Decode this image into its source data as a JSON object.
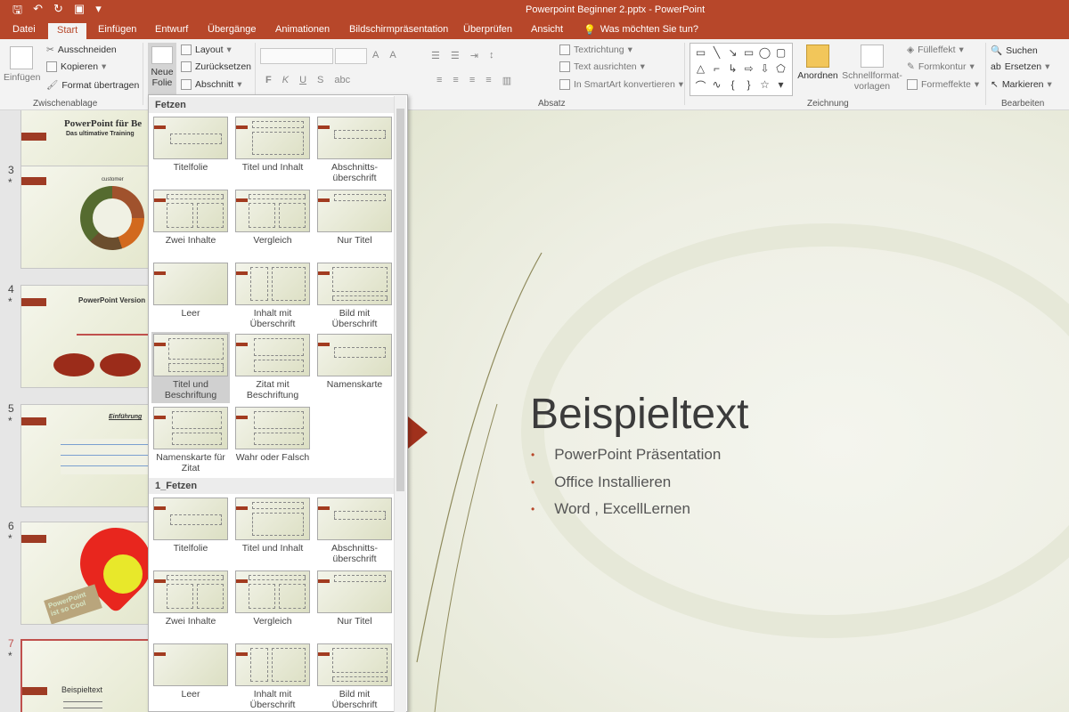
{
  "window": {
    "doc_title": "Powerpoint Beginner 2.pptx - PowerPoint"
  },
  "tabs": [
    "Datei",
    "Start",
    "Einfügen",
    "Entwurf",
    "Übergänge",
    "Animationen",
    "Bildschirmpräsentation",
    "Überprüfen",
    "Ansicht"
  ],
  "tell_me": "Was möchten Sie tun?",
  "ribbon": {
    "clipboard": {
      "paste": "Einfügen",
      "cut": "Ausschneiden",
      "copy": "Kopieren",
      "format_painter": "Format übertragen",
      "label": "Zwischenablage"
    },
    "slides": {
      "new_slide_1": "Neue",
      "new_slide_2": "Folie",
      "layout": "Layout",
      "reset": "Zurücksetzen",
      "section": "Abschnitt"
    },
    "paragraph": {
      "text_direction": "Textrichtung",
      "align_text": "Text ausrichten",
      "smartart": "In SmartArt konvertieren",
      "label": "Absatz"
    },
    "drawing": {
      "arrange": "Anordnen",
      "quick_styles_1": "Schnellformat-",
      "quick_styles_2": "vorlagen",
      "fill": "Fülleffekt",
      "outline": "Formkontur",
      "effects": "Formeffekte",
      "label": "Zeichnung"
    },
    "editing": {
      "find": "Suchen",
      "replace": "Ersetzen",
      "select": "Markieren",
      "label": "Bearbeiten"
    }
  },
  "gallery": {
    "section1": "Fetzen",
    "section2": "1_Fetzen",
    "layouts1": [
      {
        "l1": "Titelfolie",
        "l2": ""
      },
      {
        "l1": "Titel und Inhalt",
        "l2": ""
      },
      {
        "l1": "Abschnitts-",
        "l2": "überschrift"
      },
      {
        "l1": "Zwei Inhalte",
        "l2": ""
      },
      {
        "l1": "Vergleich",
        "l2": ""
      },
      {
        "l1": "Nur Titel",
        "l2": ""
      },
      {
        "l1": "Leer",
        "l2": ""
      },
      {
        "l1": "Inhalt mit",
        "l2": "Überschrift"
      },
      {
        "l1": "Bild mit",
        "l2": "Überschrift"
      },
      {
        "l1": "Titel und",
        "l2": "Beschriftung"
      },
      {
        "l1": "Zitat mit",
        "l2": "Beschriftung"
      },
      {
        "l1": "Namenskarte",
        "l2": ""
      },
      {
        "l1": "Namenskarte für",
        "l2": "Zitat"
      },
      {
        "l1": "Wahr oder Falsch",
        "l2": ""
      }
    ],
    "layouts2": [
      {
        "l1": "Titelfolie",
        "l2": ""
      },
      {
        "l1": "Titel und Inhalt",
        "l2": ""
      },
      {
        "l1": "Abschnitts-",
        "l2": "überschrift"
      },
      {
        "l1": "Zwei Inhalte",
        "l2": ""
      },
      {
        "l1": "Vergleich",
        "l2": ""
      },
      {
        "l1": "Nur Titel",
        "l2": ""
      },
      {
        "l1": "Leer",
        "l2": ""
      },
      {
        "l1": "Inhalt mit",
        "l2": "Überschrift"
      },
      {
        "l1": "Bild mit",
        "l2": "Überschrift"
      }
    ]
  },
  "thumbnails": {
    "slide2_title": "PowerPoint für Be",
    "slide2_sub": "Das ultimative Training",
    "slide3_title": "customer",
    "slide4_title": "PowerPoint Version",
    "slide5_title": "Einführung",
    "slide6_badge": "PowerPoint ist so Cool",
    "slide7_title": "Beispieltext",
    "numbers": [
      "3",
      "4",
      "5",
      "6",
      "7"
    ],
    "star": "*"
  },
  "slide": {
    "title": "Beispieltext",
    "bullets": [
      "PowerPoint Präsentation",
      "Office Installieren",
      "Word , ExcellLernen"
    ]
  },
  "colors": {
    "accent": "#b7472a",
    "tag": "#9e3b24"
  }
}
